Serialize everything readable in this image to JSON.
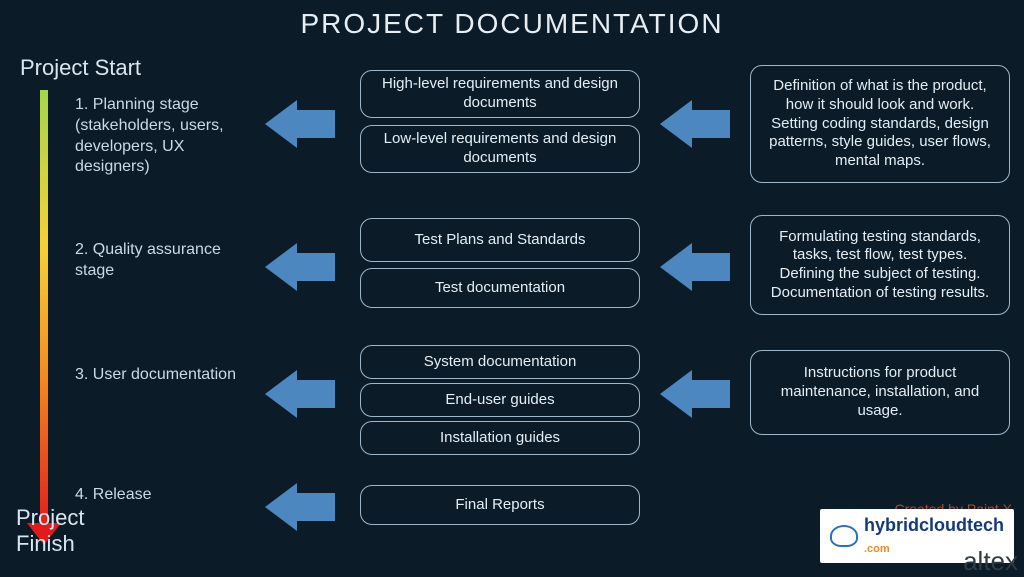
{
  "title": "PROJECT DOCUMENTATION",
  "timeline": {
    "start": "Project Start",
    "finish": "Project Finish"
  },
  "stages": [
    {
      "label": "1. Planning stage (stakeholders, users, developers, UX designers)"
    },
    {
      "label": "2. Quality assurance stage"
    },
    {
      "label": "3. User documentation"
    },
    {
      "label": "4. Release"
    }
  ],
  "mid_boxes": {
    "r1a": "High-level requirements and design documents",
    "r1b": "Low-level requirements and design documents",
    "r2a": "Test Plans and Standards",
    "r2b": "Test documentation",
    "r3a": "System documentation",
    "r3b": "End-user guides",
    "r3c": "Installation guides",
    "r4a": "Final Reports"
  },
  "right_boxes": {
    "r1": "Definition of what is the product, how it should look and work. Setting coding standards, design patterns, style guides, user flows, mental maps.",
    "r2": "Formulating testing standards, tasks, test flow, test types. Defining the subject of testing. Documentation of testing results.",
    "r3": "Instructions for product maintenance, installation, and usage."
  },
  "footer": {
    "created": "Created by Paint X",
    "logo_text": "hybridcloudtech",
    "logo_suffix": ".com",
    "altex": "altex"
  }
}
